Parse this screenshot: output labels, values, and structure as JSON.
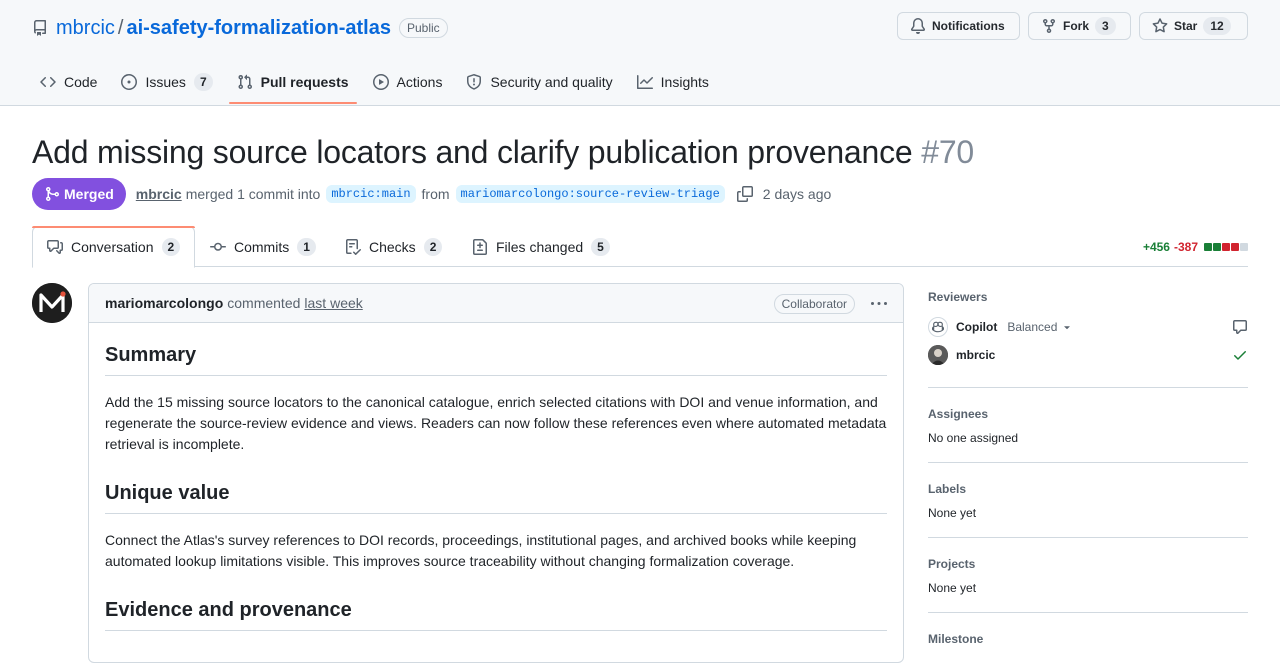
{
  "repo": {
    "owner": "mbrcic",
    "name": "ai-safety-formalization-atlas",
    "visibility": "Public"
  },
  "actions": {
    "notifications": "Notifications",
    "fork": "Fork",
    "fork_count": "3",
    "star": "Star",
    "star_count": "12"
  },
  "nav": {
    "code": "Code",
    "issues": "Issues",
    "issues_count": "7",
    "pull_requests": "Pull requests",
    "actions": "Actions",
    "security": "Security and quality",
    "insights": "Insights"
  },
  "pr": {
    "title": "Add missing source locators and clarify publication provenance",
    "number": "#70",
    "state": "Merged",
    "author": "mbrcic",
    "merge_text": "merged 1 commit into",
    "base_branch": "mbrcic:main",
    "from_text": "from",
    "head_branch": "mariomarcolongo:source-review-triage",
    "time": "2 days ago"
  },
  "tabs": {
    "conversation": "Conversation",
    "conversation_count": "2",
    "commits": "Commits",
    "commits_count": "1",
    "checks": "Checks",
    "checks_count": "2",
    "files": "Files changed",
    "files_count": "5"
  },
  "diffstat": {
    "additions": "+456",
    "deletions": "-387",
    "colors": {
      "add": "#1a7f37",
      "del": "#d1242f",
      "neutral": "#d1d9e0"
    }
  },
  "comment": {
    "author": "mariomarcolongo",
    "verb": "commented",
    "time": "last week",
    "role": "Collaborator",
    "sections": {
      "summary_heading": "Summary",
      "summary_text": "Add the 15 missing source locators to the canonical catalogue, enrich selected citations with DOI and venue information, and regenerate the source-review evidence and views. Readers can now follow these references even where automated metadata retrieval is incomplete.",
      "unique_heading": "Unique value",
      "unique_text": "Connect the Atlas's survey references to DOI records, proceedings, institutional pages, and archived books while keeping automated lookup limitations visible. This improves source traceability without changing formalization coverage.",
      "evidence_heading": "Evidence and provenance"
    }
  },
  "sidebar": {
    "reviewers_heading": "Reviewers",
    "reviewer_copilot": "Copilot",
    "copilot_mode": "Balanced",
    "reviewer_user": "mbrcic",
    "assignees_heading": "Assignees",
    "assignees_value": "No one assigned",
    "labels_heading": "Labels",
    "labels_value": "None yet",
    "projects_heading": "Projects",
    "projects_value": "None yet",
    "milestone_heading": "Milestone"
  },
  "colors": {
    "accent": "#0969da",
    "merged": "#8250df",
    "tab_underline": "#fd8c73",
    "success": "#1a7f37"
  }
}
